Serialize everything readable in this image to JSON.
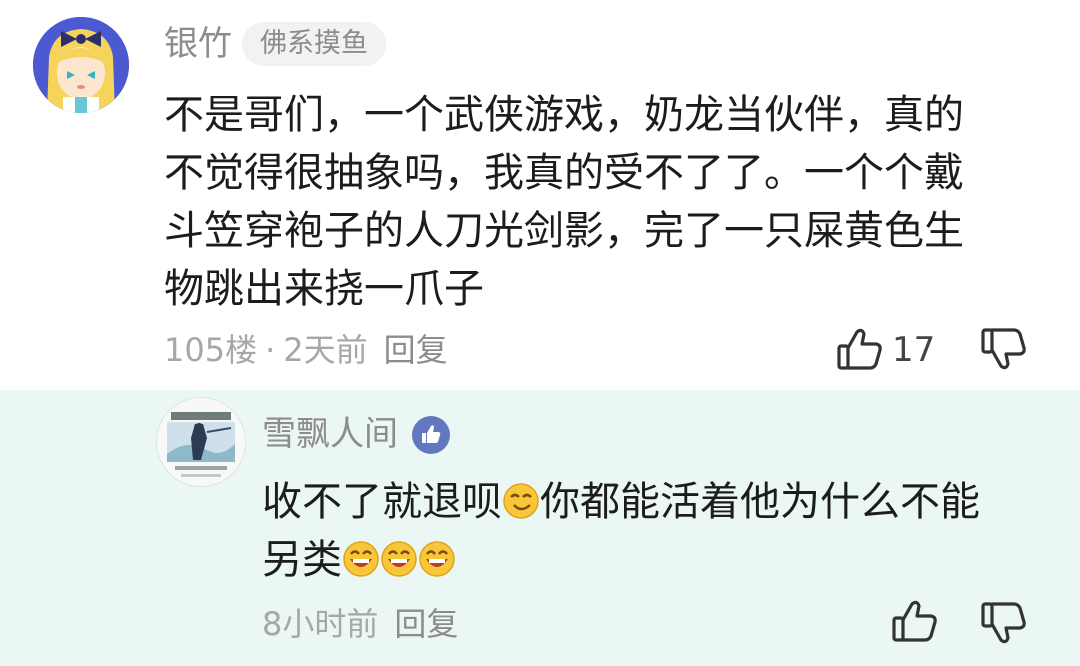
{
  "comment": {
    "username": "银竹",
    "badge": "佛系摸鱼",
    "lines": [
      "不是哥们，一个武侠游戏，奶龙当伙伴，真的",
      "不觉得很抽象吗，我真的受不了了。一个个戴",
      "斗笠穿袍子的人刀光剑影，完了一只屎黄色生",
      "物跳出来挠一爪子"
    ],
    "floor": "105楼",
    "time": "2天前",
    "reply_label": "回复",
    "like_count": "17"
  },
  "reply": {
    "username": "雪飘人间",
    "line1_before": "收不了就退呗",
    "line1_after": "你都能活着他为什么不能",
    "line2_text": "另类",
    "time": "8小时前",
    "reply_label": "回复"
  },
  "icons": {
    "like": "thumbs-up-icon",
    "dislike": "thumbs-down-icon",
    "verified": "thumbs-up-badge-icon",
    "emoji_smirk": "smirk-emoji-icon",
    "emoji_grin": "grinning-emoji-icon"
  },
  "colors": {
    "reply_background": "#eaf7f5",
    "username": "#8c8c8c",
    "meta": "#a7a7a7",
    "body": "#1c1c1c"
  }
}
